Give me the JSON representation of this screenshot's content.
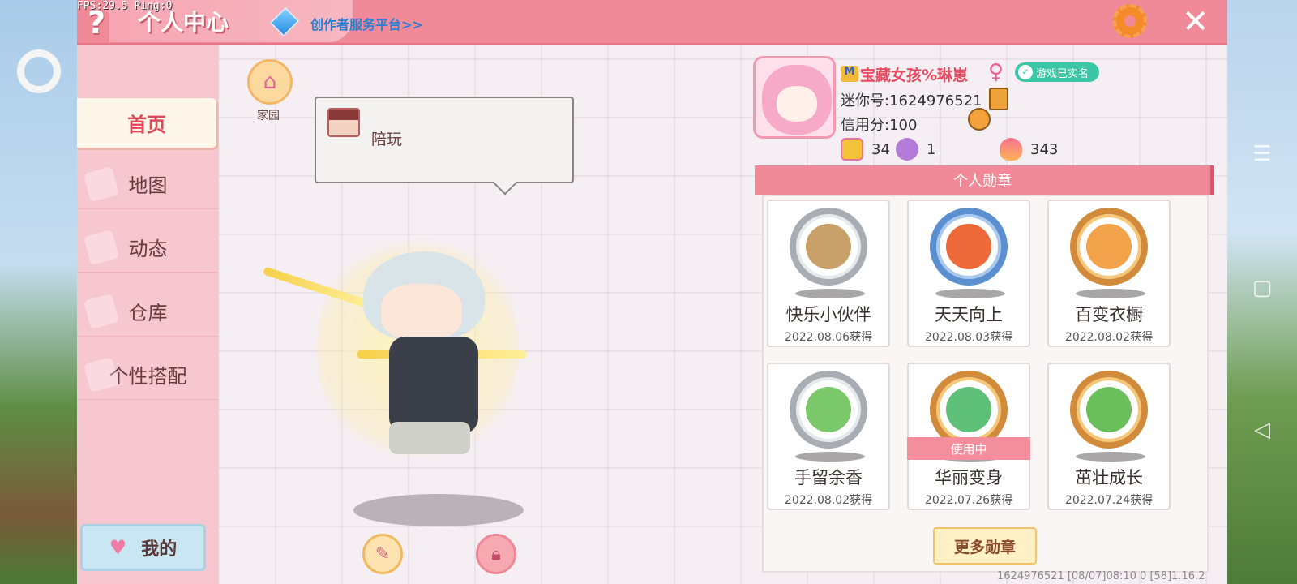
{
  "overlay": {
    "fps_text": "FPS:29.5  Ping:0"
  },
  "header": {
    "help_glyph": "?",
    "title": "个人中心",
    "creator_link": "创作者服务平台>>",
    "close_glyph": "✕"
  },
  "sidebar": {
    "items": [
      {
        "label": "首页",
        "active": true
      },
      {
        "label": "地图"
      },
      {
        "label": "动态"
      },
      {
        "label": "仓库"
      },
      {
        "label": "个性搭配"
      }
    ],
    "my_button": {
      "label": "我的",
      "icon": "heart-icon"
    }
  },
  "home": {
    "label": "家园",
    "icon": "house-icon"
  },
  "speech_bubble": {
    "text": "陪玩"
  },
  "profile": {
    "nickname": "宝藏女孩%琳崽",
    "vip_glyph": "M",
    "gender_glyph": "♀",
    "verified_label": "游戏已实名",
    "mini_id": "迷你号:1624976521",
    "credit": "信用分:100",
    "stats": {
      "likes": "34",
      "popularity": "1",
      "fire": "343"
    }
  },
  "badges": {
    "header": "个人勋章",
    "items": [
      {
        "name": "快乐小伙伴",
        "date": "2022.08.06获得",
        "tier": "silver",
        "in_use": false
      },
      {
        "name": "天天向上",
        "date": "2022.08.03获得",
        "tier": "blue",
        "in_use": false
      },
      {
        "name": "百变衣橱",
        "date": "2022.08.02获得",
        "tier": "gold",
        "in_use": false
      },
      {
        "name": "手留余香",
        "date": "2022.08.02获得",
        "tier": "silver",
        "in_use": false
      },
      {
        "name": "华丽变身",
        "date": "2022.07.26获得",
        "tier": "gold",
        "in_use": true
      },
      {
        "name": "茁壮成长",
        "date": "2022.07.24获得",
        "tier": "gold",
        "in_use": false
      }
    ],
    "in_use_label": "使用中",
    "more_button": "更多勋章"
  },
  "footer": {
    "info": "1624976521   [08/07]08:10 0  [58]1.16.2"
  },
  "colors": {
    "accent": "#f08a98",
    "title_red": "#e64b62",
    "panel_bg": "#f5eef2"
  },
  "icons": [
    "help-icon",
    "cube-icon",
    "gear-icon",
    "close-icon",
    "house-icon",
    "pencil-icon",
    "lock-icon",
    "copy-icon",
    "friend-icon",
    "female-icon"
  ]
}
